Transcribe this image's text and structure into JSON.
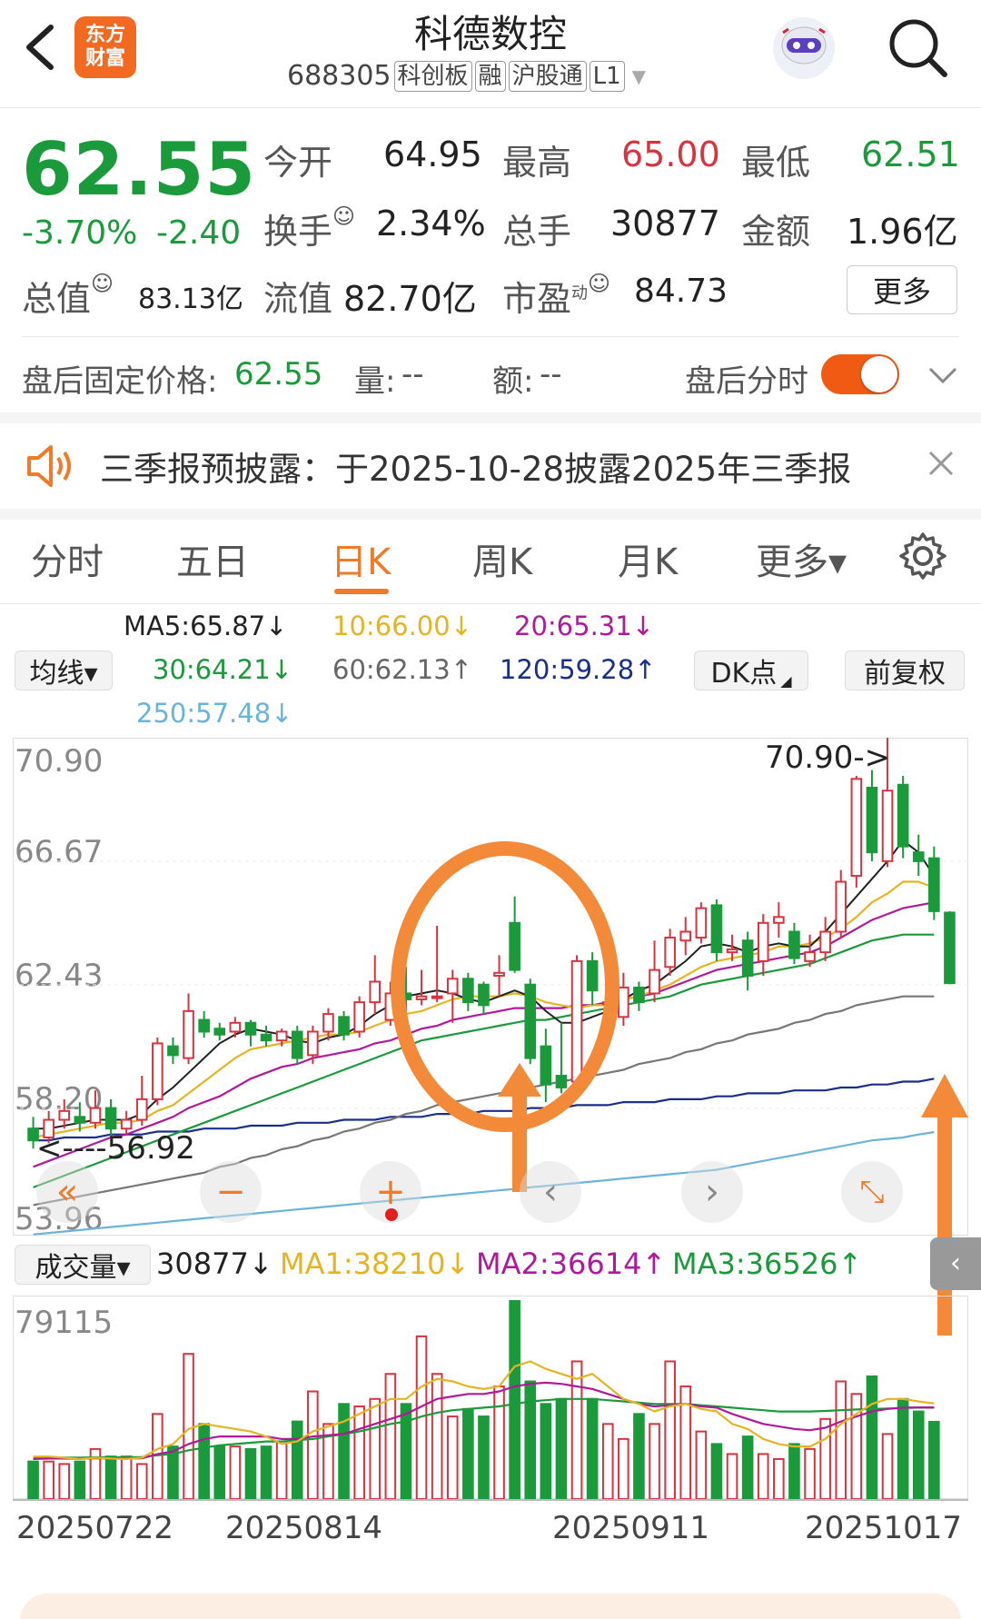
{
  "header": {
    "back_icon": "chevron-left-icon",
    "logo_text": "东方\n财富",
    "title": "科德数控",
    "code": "688305",
    "tags": [
      "科创板",
      "融",
      "沪股通",
      "L1"
    ],
    "robot_icon": "robot-assistant-icon",
    "search_icon": "search-icon"
  },
  "quote": {
    "price": "62.55",
    "change_pct": "-3.70%",
    "change": "-2.40",
    "open_label": "今开",
    "open": "64.95",
    "high_label": "最高",
    "high": "65.00",
    "low_label": "最低",
    "low": "62.51",
    "turnover_label": "换手",
    "turnover": "2.34%",
    "volume_label": "总手",
    "volume": "30877",
    "amount_label": "金额",
    "amount": "1.96亿",
    "mktcap_label": "总值",
    "mktcap": "83.13亿",
    "float_label": "流值",
    "float_cap": "82.70亿",
    "pe_label": "市盈",
    "pe_sup": "动",
    "pe": "84.73",
    "more_button": "更多"
  },
  "after_hours": {
    "label": "盘后固定价格:",
    "price": "62.55",
    "vol_label": "量:",
    "vol": "--",
    "amt_label": "额:",
    "amt": "--",
    "toggle_label": "盘后分时",
    "toggle_on": true
  },
  "notice": {
    "text": "三季报预披露：于2025-10-28披露2025年三季报"
  },
  "tabs": [
    "分时",
    "五日",
    "日K",
    "周K",
    "月K",
    "更多▾"
  ],
  "active_tab": 2,
  "ma": {
    "selector": "均线▾",
    "ma5": "MA5:65.87↓",
    "ma10": "10:66.00↓",
    "ma20": "20:65.31↓",
    "ma30": "30:64.21↓",
    "ma60": "60:62.13↑",
    "ma120": "120:59.28↑",
    "ma250": "250:57.48↓",
    "dk_button": "DK点",
    "adjust_button": "前复权"
  },
  "price_axis": [
    "70.90",
    "66.67",
    "62.43",
    "58.20",
    "53.96"
  ],
  "annotations": {
    "high": "70.90->",
    "low": "<----56.92"
  },
  "volume": {
    "selector": "成交量▾",
    "current": "30877↓",
    "ma1": "MA1:38210↓",
    "ma2": "MA2:36614↑",
    "ma3": "MA3:36526↑",
    "axis_max": "79115"
  },
  "dates": [
    "20250722",
    "20250814",
    "20250911",
    "20251017"
  ],
  "colors": {
    "up": "#d9333f",
    "down": "#1a9a3a",
    "accent": "#f07a28",
    "ma5": "#222222",
    "ma10": "#e6b422",
    "ma20": "#b01a9a",
    "ma30": "#1a9a3a",
    "ma60": "#777777",
    "ma120": "#1a2f8a",
    "ma250": "#6ab4dc"
  },
  "chart_data": {
    "type": "candlestick",
    "ylim": [
      53.96,
      70.9
    ],
    "candles": [
      {
        "o": 57.6,
        "c": 57.2,
        "h": 58.0,
        "l": 56.92
      },
      {
        "o": 57.3,
        "c": 57.9,
        "h": 58.2,
        "l": 57.1
      },
      {
        "o": 57.9,
        "c": 58.2,
        "h": 58.6,
        "l": 57.6
      },
      {
        "o": 58.0,
        "c": 57.8,
        "h": 58.5,
        "l": 57.5
      },
      {
        "o": 57.8,
        "c": 58.3,
        "h": 58.9,
        "l": 57.6
      },
      {
        "o": 58.3,
        "c": 57.6,
        "h": 58.6,
        "l": 57.3
      },
      {
        "o": 57.6,
        "c": 57.9,
        "h": 58.2,
        "l": 57.4
      },
      {
        "o": 57.9,
        "c": 58.6,
        "h": 59.4,
        "l": 57.7
      },
      {
        "o": 58.6,
        "c": 60.5,
        "h": 60.7,
        "l": 58.4
      },
      {
        "o": 60.4,
        "c": 60.1,
        "h": 60.7,
        "l": 59.8
      },
      {
        "o": 60.0,
        "c": 61.6,
        "h": 62.2,
        "l": 59.8
      },
      {
        "o": 61.3,
        "c": 60.9,
        "h": 61.6,
        "l": 60.7
      },
      {
        "o": 61.0,
        "c": 60.8,
        "h": 61.2,
        "l": 60.6
      },
      {
        "o": 60.9,
        "c": 61.2,
        "h": 61.4,
        "l": 60.7
      },
      {
        "o": 61.2,
        "c": 60.8,
        "h": 61.3,
        "l": 60.4
      },
      {
        "o": 60.8,
        "c": 60.6,
        "h": 61.1,
        "l": 60.4
      },
      {
        "o": 60.6,
        "c": 60.9,
        "h": 61.0,
        "l": 60.4
      },
      {
        "o": 60.9,
        "c": 60.0,
        "h": 61.1,
        "l": 59.8
      },
      {
        "o": 60.1,
        "c": 60.9,
        "h": 61.1,
        "l": 59.8
      },
      {
        "o": 60.9,
        "c": 61.5,
        "h": 61.7,
        "l": 60.6
      },
      {
        "o": 61.4,
        "c": 60.8,
        "h": 61.6,
        "l": 60.6
      },
      {
        "o": 60.9,
        "c": 61.9,
        "h": 62.1,
        "l": 60.7
      },
      {
        "o": 61.9,
        "c": 62.6,
        "h": 63.5,
        "l": 61.5
      },
      {
        "o": 61.3,
        "c": 62.2,
        "h": 62.6,
        "l": 61.1
      },
      {
        "o": 62.2,
        "c": 62.0,
        "h": 63.1,
        "l": 61.6
      },
      {
        "o": 62.0,
        "c": 62.1,
        "h": 63.0,
        "l": 61.8
      },
      {
        "o": 62.1,
        "c": 62.1,
        "h": 64.5,
        "l": 61.9
      },
      {
        "o": 62.2,
        "c": 62.7,
        "h": 63.0,
        "l": 61.2
      },
      {
        "o": 62.7,
        "c": 61.9,
        "h": 62.9,
        "l": 61.6
      },
      {
        "o": 62.5,
        "c": 61.8,
        "h": 62.6,
        "l": 61.5
      },
      {
        "o": 62.8,
        "c": 62.9,
        "h": 63.5,
        "l": 62.1
      },
      {
        "o": 64.6,
        "c": 63.0,
        "h": 65.5,
        "l": 62.9
      },
      {
        "o": 62.5,
        "c": 60.0,
        "h": 62.7,
        "l": 59.8
      },
      {
        "o": 60.4,
        "c": 59.1,
        "h": 61.0,
        "l": 58.5
      },
      {
        "o": 59.4,
        "c": 59.0,
        "h": 61.2,
        "l": 58.8
      },
      {
        "o": 59.2,
        "c": 63.3,
        "h": 63.5,
        "l": 59.0
      },
      {
        "o": 63.3,
        "c": 62.3,
        "h": 63.6,
        "l": 61.8
      },
      {
        "o": 61.9,
        "c": 61.9,
        "h": 62.5,
        "l": 61.2
      },
      {
        "o": 61.4,
        "c": 62.4,
        "h": 62.9,
        "l": 61.1
      },
      {
        "o": 62.4,
        "c": 61.9,
        "h": 62.6,
        "l": 61.6
      },
      {
        "o": 62.2,
        "c": 63.0,
        "h": 64.0,
        "l": 61.9
      },
      {
        "o": 63.1,
        "c": 64.1,
        "h": 64.4,
        "l": 62.8
      },
      {
        "o": 64.0,
        "c": 64.3,
        "h": 64.8,
        "l": 63.5
      },
      {
        "o": 64.1,
        "c": 65.1,
        "h": 65.3,
        "l": 63.9
      },
      {
        "o": 65.2,
        "c": 63.6,
        "h": 65.4,
        "l": 63.3
      },
      {
        "o": 63.6,
        "c": 63.7,
        "h": 64.2,
        "l": 63.3
      },
      {
        "o": 64.0,
        "c": 62.8,
        "h": 64.3,
        "l": 62.3
      },
      {
        "o": 63.3,
        "c": 64.6,
        "h": 64.9,
        "l": 62.8
      },
      {
        "o": 64.6,
        "c": 64.8,
        "h": 65.3,
        "l": 64.1
      },
      {
        "o": 64.3,
        "c": 63.4,
        "h": 64.6,
        "l": 63.2
      },
      {
        "o": 63.3,
        "c": 63.6,
        "h": 64.2,
        "l": 63.1
      },
      {
        "o": 63.6,
        "c": 64.3,
        "h": 64.8,
        "l": 63.3
      },
      {
        "o": 64.3,
        "c": 66.0,
        "h": 66.4,
        "l": 64.1
      },
      {
        "o": 66.2,
        "c": 69.5,
        "h": 69.6,
        "l": 65.8
      },
      {
        "o": 69.2,
        "c": 67.0,
        "h": 69.8,
        "l": 66.7
      },
      {
        "o": 66.7,
        "c": 69.1,
        "h": 70.9,
        "l": 66.5
      },
      {
        "o": 69.3,
        "c": 67.2,
        "h": 69.6,
        "l": 66.8
      },
      {
        "o": 67.0,
        "c": 66.7,
        "h": 67.6,
        "l": 66.2
      },
      {
        "o": 66.8,
        "c": 65.0,
        "h": 67.2,
        "l": 64.7
      },
      {
        "o": 64.95,
        "c": 62.55,
        "h": 65.0,
        "l": 62.51
      }
    ],
    "ma_lines": {
      "ma5": [
        57.6,
        57.6,
        57.7,
        57.8,
        57.9,
        57.9,
        57.9,
        58.1,
        58.6,
        59.0,
        59.5,
        60.0,
        60.5,
        60.8,
        61.0,
        60.9,
        60.8,
        60.6,
        60.5,
        60.7,
        60.8,
        61.1,
        61.5,
        61.8,
        62.1,
        62.2,
        62.3,
        62.2,
        62.0,
        61.9,
        62.1,
        62.3,
        62.1,
        61.6,
        61.2,
        61.2,
        61.4,
        61.6,
        62.0,
        62.3,
        62.5,
        62.9,
        63.3,
        63.8,
        63.9,
        63.8,
        63.6,
        63.8,
        63.9,
        63.8,
        63.8,
        64.3,
        64.9,
        65.5,
        66.1,
        66.7,
        67.4,
        67.0,
        66.2
      ],
      "ma10": [
        57.3,
        57.4,
        57.5,
        57.6,
        57.7,
        57.8,
        57.8,
        57.9,
        58.2,
        58.4,
        58.8,
        59.2,
        59.6,
        60.0,
        60.3,
        60.4,
        60.5,
        60.6,
        60.7,
        60.8,
        60.8,
        60.9,
        61.1,
        61.3,
        61.5,
        61.6,
        61.8,
        62.0,
        62.1,
        62.1,
        62.1,
        62.2,
        62.1,
        61.9,
        61.8,
        61.7,
        61.8,
        61.8,
        62.0,
        62.1,
        62.3,
        62.5,
        62.8,
        63.1,
        63.3,
        63.4,
        63.5,
        63.6,
        63.8,
        63.8,
        63.9,
        64.1,
        64.4,
        64.8,
        65.3,
        65.6,
        66.0,
        66.0,
        65.8
      ],
      "ma20": [
        56.3,
        56.5,
        56.7,
        56.9,
        57.1,
        57.3,
        57.4,
        57.6,
        57.8,
        58.0,
        58.3,
        58.5,
        58.7,
        59.0,
        59.3,
        59.5,
        59.7,
        59.8,
        60.0,
        60.1,
        60.2,
        60.3,
        60.5,
        60.6,
        60.8,
        61.0,
        61.1,
        61.3,
        61.4,
        61.5,
        61.6,
        61.7,
        61.7,
        61.7,
        61.7,
        61.8,
        61.8,
        61.9,
        62.0,
        62.1,
        62.2,
        62.4,
        62.6,
        62.8,
        63.0,
        63.1,
        63.2,
        63.3,
        63.4,
        63.5,
        63.6,
        63.8,
        64.1,
        64.4,
        64.7,
        64.9,
        65.1,
        65.2,
        65.3
      ],
      "ma30": [
        55.6,
        55.8,
        56.0,
        56.2,
        56.4,
        56.6,
        56.8,
        57.0,
        57.2,
        57.4,
        57.6,
        57.8,
        58.0,
        58.2,
        58.4,
        58.6,
        58.8,
        59.0,
        59.2,
        59.4,
        59.6,
        59.8,
        60.0,
        60.2,
        60.4,
        60.6,
        60.7,
        60.8,
        60.9,
        61.0,
        61.1,
        61.2,
        61.3,
        61.3,
        61.4,
        61.5,
        61.6,
        61.7,
        61.8,
        61.9,
        62.0,
        62.1,
        62.3,
        62.5,
        62.6,
        62.7,
        62.8,
        62.9,
        63.0,
        63.1,
        63.2,
        63.4,
        63.6,
        63.8,
        64.0,
        64.1,
        64.2,
        64.2,
        64.2
      ],
      "ma60": [
        55.0,
        55.1,
        55.2,
        55.3,
        55.4,
        55.5,
        55.6,
        55.7,
        55.8,
        55.9,
        56.0,
        56.1,
        56.3,
        56.4,
        56.6,
        56.7,
        56.9,
        57.0,
        57.2,
        57.3,
        57.5,
        57.6,
        57.8,
        57.9,
        58.1,
        58.2,
        58.4,
        58.5,
        58.6,
        58.7,
        58.8,
        58.9,
        59.0,
        59.1,
        59.2,
        59.3,
        59.4,
        59.5,
        59.6,
        59.8,
        59.9,
        60.0,
        60.2,
        60.3,
        60.5,
        60.6,
        60.8,
        60.9,
        61.0,
        61.2,
        61.3,
        61.5,
        61.6,
        61.8,
        61.9,
        62.0,
        62.1,
        62.1,
        62.1
      ],
      "ma120": [
        57.2,
        57.2,
        57.3,
        57.3,
        57.3,
        57.4,
        57.4,
        57.4,
        57.5,
        57.5,
        57.5,
        57.6,
        57.6,
        57.6,
        57.7,
        57.7,
        57.7,
        57.8,
        57.8,
        57.8,
        57.9,
        57.9,
        57.9,
        58.0,
        58.0,
        58.0,
        58.1,
        58.1,
        58.1,
        58.2,
        58.2,
        58.2,
        58.3,
        58.3,
        58.3,
        58.4,
        58.4,
        58.4,
        58.5,
        58.5,
        58.5,
        58.6,
        58.6,
        58.6,
        58.7,
        58.7,
        58.8,
        58.8,
        58.8,
        58.9,
        58.9,
        58.9,
        59.0,
        59.0,
        59.1,
        59.1,
        59.2,
        59.2,
        59.3
      ],
      "ma250": [
        54.0,
        54.05,
        54.1,
        54.15,
        54.2,
        54.25,
        54.3,
        54.35,
        54.4,
        54.45,
        54.5,
        54.55,
        54.6,
        54.65,
        54.7,
        54.75,
        54.8,
        54.85,
        54.9,
        54.95,
        55.0,
        55.05,
        55.1,
        55.15,
        55.2,
        55.25,
        55.3,
        55.35,
        55.4,
        55.45,
        55.5,
        55.55,
        55.6,
        55.65,
        55.7,
        55.75,
        55.8,
        55.85,
        55.9,
        55.95,
        56.0,
        56.05,
        56.1,
        56.15,
        56.2,
        56.3,
        56.4,
        56.5,
        56.6,
        56.7,
        56.8,
        56.9,
        57.0,
        57.1,
        57.2,
        57.25,
        57.3,
        57.4,
        57.48
      ]
    },
    "volume_ylim": [
      0,
      79115
    ],
    "volumes": [
      15000,
      15000,
      14000,
      15000,
      20000,
      17000,
      17000,
      14000,
      34000,
      21000,
      58000,
      30000,
      21000,
      21000,
      20000,
      21000,
      23000,
      31000,
      43000,
      30000,
      38000,
      37000,
      40000,
      50000,
      38000,
      65000,
      50000,
      33000,
      36000,
      33000,
      45000,
      79115,
      47000,
      38000,
      40000,
      55000,
      40000,
      30000,
      24000,
      34000,
      30000,
      55000,
      45000,
      27000,
      22000,
      18000,
      25000,
      18000,
      16000,
      22000,
      20000,
      32000,
      47000,
      42000,
      49000,
      26000,
      40000,
      35000,
      30877
    ],
    "volume_ma1": [
      17000,
      17000,
      16500,
      16000,
      16500,
      16200,
      16000,
      16500,
      20000,
      22000,
      28000,
      30000,
      29000,
      28000,
      27000,
      25000,
      22000,
      23000,
      27000,
      29000,
      31000,
      34000,
      37000,
      40000,
      40000,
      45000,
      48000,
      47000,
      45000,
      44000,
      45000,
      53000,
      55000,
      52000,
      50000,
      48000,
      50000,
      45000,
      40000,
      38000,
      35000,
      37000,
      38000,
      36000,
      35000,
      30000,
      28000,
      24000,
      22000,
      21000,
      21000,
      24000,
      30000,
      34000,
      38000,
      40000,
      40000,
      39000,
      38210
    ],
    "volume_ma2": [
      16000,
      16200,
      16200,
      16100,
      16300,
      16300,
      16200,
      16300,
      18000,
      19000,
      22000,
      24000,
      25000,
      25000,
      25000,
      25000,
      24000,
      24000,
      25000,
      25500,
      26000,
      28000,
      30000,
      32000,
      34000,
      37000,
      40000,
      41000,
      42000,
      42000,
      43000,
      45000,
      46000,
      46500,
      46000,
      45000,
      44000,
      42000,
      40000,
      38000,
      37000,
      37500,
      38000,
      37000,
      36500,
      34000,
      32000,
      30000,
      29000,
      28000,
      27500,
      28500,
      31000,
      33000,
      35000,
      36000,
      36500,
      36600,
      36614
    ],
    "volume_ma3": [
      16500,
      16600,
      16600,
      16600,
      16700,
      16700,
      16700,
      16800,
      17500,
      18000,
      19500,
      20500,
      21500,
      22000,
      22500,
      23000,
      23000,
      23500,
      24000,
      25000,
      26000,
      27000,
      28500,
      30000,
      31000,
      33000,
      34500,
      35500,
      36000,
      36500,
      37000,
      38000,
      39000,
      39500,
      40000,
      40000,
      40000,
      39500,
      39000,
      38500,
      38000,
      38000,
      38000,
      37500,
      37000,
      36500,
      36000,
      35500,
      35000,
      35000,
      35000,
      35200,
      35500,
      35800,
      36000,
      36200,
      36400,
      36500,
      36526
    ]
  }
}
